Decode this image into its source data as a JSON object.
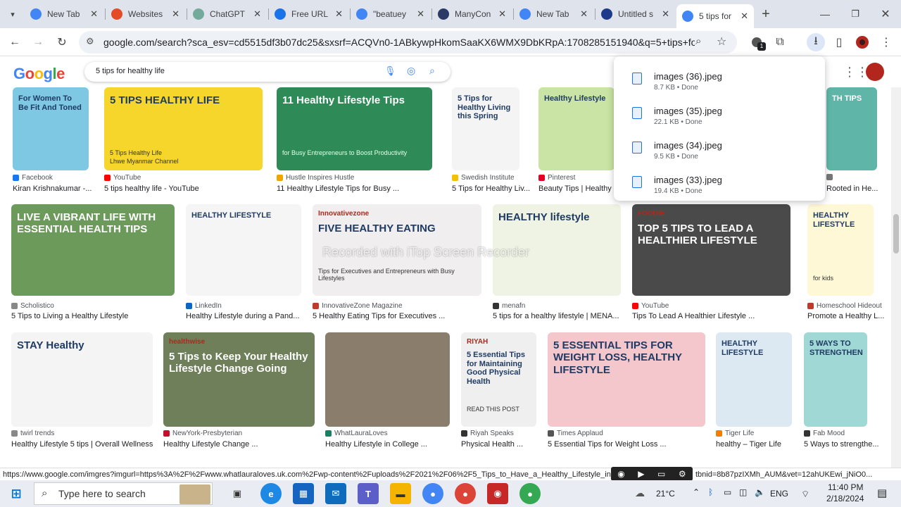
{
  "tabs": [
    {
      "title": "New Tab",
      "icon": "chrome-icon",
      "color": "#4285f4"
    },
    {
      "title": "Websites",
      "icon": "websites-icon",
      "color": "#e34c26"
    },
    {
      "title": "ChatGPT",
      "icon": "chatgpt-icon",
      "color": "#74aa9c"
    },
    {
      "title": "Free URL",
      "icon": "link-icon",
      "color": "#1a73e8"
    },
    {
      "title": "\"beatuey",
      "icon": "google-icon",
      "color": "#4285f4"
    },
    {
      "title": "ManyCon",
      "icon": "manychat-icon",
      "color": "#2b3a67"
    },
    {
      "title": "New Tab",
      "icon": "chrome-icon",
      "color": "#4285f4"
    },
    {
      "title": "Untitled s",
      "icon": "sheets-icon",
      "color": "#1e3a8a"
    },
    {
      "title": "5 tips for",
      "icon": "google-icon",
      "color": "#4285f4"
    }
  ],
  "new_tab_symbol": "+",
  "url": "google.com/search?sca_esv=cd5515df3b07dc25&sxsrf=ACQVn0-1ABkywpHkomSaaKX6WMX9DbKRpA:1708285151940&q=5+tips+for+health...",
  "google": {
    "logo": "Google",
    "query": "5 tips for healthy life"
  },
  "downloads": [
    {
      "name": "images (36).jpeg",
      "meta": "8.7 KB • Done"
    },
    {
      "name": "images (35).jpeg",
      "meta": "22.1 KB • Done"
    },
    {
      "name": "images (34).jpeg",
      "meta": "9.5 KB • Done"
    },
    {
      "name": "images (33).jpeg",
      "meta": "19.4 KB • Done"
    }
  ],
  "row1": [
    {
      "source": "Facebook",
      "title": "Kiran Krishnakumar -...",
      "img_text": "For Women To Be Fit And Toned",
      "color": "#7ec8e3",
      "src_color": "#1877f2"
    },
    {
      "source": "YouTube",
      "title": "5 tips healthy life - YouTube",
      "img_text": "5 TIPS HEALTHY LIFE",
      "img_sub": "5 Tips Healthy Life",
      "img_sub2": "Lhwe Myanmar Channel",
      "color": "#f7d62b",
      "src_color": "#ff0000"
    },
    {
      "source": "Hustle Inspires Hustle",
      "title": "11 Healthy Lifestyle Tips for Busy ...",
      "img_text": "11 Healthy Lifestyle Tips",
      "img_sub": "for Busy Entrepreneurs to Boost Productivity",
      "color": "#2e8b57",
      "src_color": "#f0a500"
    },
    {
      "source": "Swedish Institute",
      "title": "5 Tips for Healthy Liv...",
      "img_text": "5 Tips for Healthy Living this Spring",
      "color": "#f4f4f4",
      "src_color": "#f2c200"
    },
    {
      "source": "Pinterest",
      "title": "Beauty Tips | Healthy li...",
      "img_text": "Healthy Lifestyle",
      "color": "#c9e4a4",
      "src_color": "#e60023"
    },
    {
      "source": "",
      "title": "Rooted in He...",
      "img_text": "TH TIPS",
      "color": "#5fb6a8",
      "src_color": "#777"
    }
  ],
  "row2": [
    {
      "source": "Scholistico",
      "title": "5 Tips to Living a Healthy Lifestyle",
      "img_text": "LIVE A VIBRANT LIFE WITH ESSENTIAL HEALTH TIPS",
      "color": "#6b9a5a",
      "src_color": "#888"
    },
    {
      "source": "LinkedIn",
      "title": "Healthy Lifestyle during a Pand...",
      "img_text": "HEALTHY LIFESTYLE",
      "color": "#f5f5f5",
      "src_color": "#0a66c2"
    },
    {
      "source": "InnovativeZone Magazine",
      "title": "5 Healthy Eating Tips for Executives ...",
      "img_text": "FIVE HEALTHY EATING",
      "img_sub": "Tips for Executives and Entrepreneurs with Busy Lifestyles",
      "img_brand": "Innovativezone",
      "color": "#f0eeee",
      "src_color": "#c0392b"
    },
    {
      "source": "menafn",
      "title": "5 tips for a healthy lifestyle | MENA...",
      "img_text": "HEALTHY lifestyle",
      "color": "#eef3e3",
      "src_color": "#333"
    },
    {
      "source": "YouTube",
      "title": "Tips To Lead A Healthier Lifestyle ...",
      "img_text": "TOP 5 TIPS TO LEAD A HEALTHIER LIFESTYLE",
      "img_brand": "FOODIE",
      "color": "#4a4a4a",
      "src_color": "#ff0000"
    },
    {
      "source": "Homeschool Hideout",
      "title": "Promote a Healthy L...",
      "img_text": "HEALTHY LIFESTYLE",
      "img_sub": "for kids",
      "color": "#fff8d6",
      "src_color": "#c0392b"
    }
  ],
  "row3": [
    {
      "source": "twirl trends",
      "title": "Healthy Lifestyle 5 tips | Overall Wellness",
      "img_text": "STAY Healthy",
      "color": "#f4f4f4",
      "src_color": "#888"
    },
    {
      "source": "NewYork-Presbyterian",
      "title": "Healthy Lifestyle Change ...",
      "img_text": "5 Tips to Keep Your Healthy Lifestyle Change Going",
      "img_brand": "healthwise",
      "color": "#6e7f5a",
      "src_color": "#c8102e"
    },
    {
      "source": "WhatLauraLoves",
      "title": "Healthy Lifestyle in College ...",
      "img_text": "",
      "color": "#8b7d6b",
      "src_color": "#1a7f64"
    },
    {
      "source": "Riyah Speaks",
      "title": "Physical Health ...",
      "img_text": "5 Essential Tips for Maintaining Good Physical Health",
      "img_brand": "RIYAH",
      "img_sub": "READ THIS POST",
      "color": "#efefef",
      "src_color": "#333"
    },
    {
      "source": "Times Applaud",
      "title": "5 Essential Tips for Weight Loss ...",
      "img_text": "5 ESSENTIAL TIPS FOR WEIGHT LOSS, HEALTHY LIFESTYLE",
      "color": "#f4c7cd",
      "src_color": "#555"
    },
    {
      "source": "Tiger Life",
      "title": "healthy – Tiger Life",
      "img_text": "HEALTHY LIFESTYLE",
      "color": "#dce9f3",
      "src_color": "#f57c00"
    },
    {
      "source": "Fab Mood",
      "title": "5 Ways to strengthe...",
      "img_text": "5 WAYS TO STRENGTHEN",
      "color": "#9fd8d4",
      "src_color": "#333"
    }
  ],
  "watermark": "Recorded with iTop Screen Recorder",
  "status_url": "https://www.google.com/imgres?imgurl=https%3A%2F%2Fwww.whatlauraloves.uk.com%2Fwp-content%2Fuploads%2F2021%2F06%2F5_Tips_to_Have_a_Healthy_Lifestyle_in_C",
  "status_url_end": "tbnid=8b87pzIXMh_AUM&vet=12ahUKEwi_jNiO0...",
  "taskbar": {
    "search_placeholder": "Type here to search",
    "temperature": "21°C",
    "language": "ENG",
    "time": "11:40 PM",
    "date": "2/18/2024"
  }
}
